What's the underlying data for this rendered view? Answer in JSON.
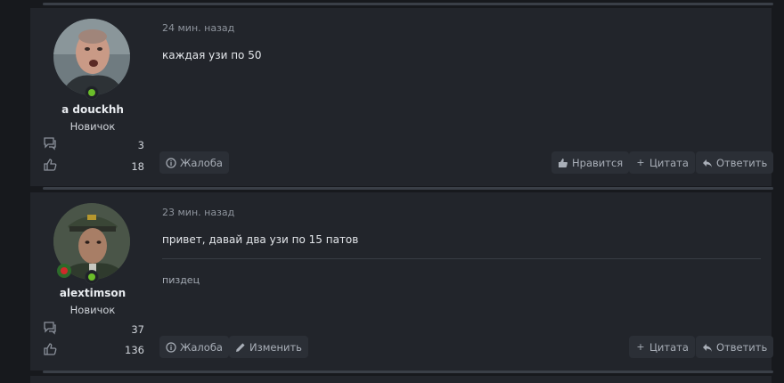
{
  "posts": [
    {
      "time": "24 мин. назад",
      "username": "a douckhh",
      "rank": "Новичок",
      "messages_count": "3",
      "likes_count": "18",
      "text": "каждая узи по 50",
      "signature": "",
      "buttons": {
        "report": "Жалоба",
        "like": "Нравится",
        "quote": "Цитата",
        "reply": "Ответить"
      }
    },
    {
      "time": "23 мин. назад",
      "username": "alextimson",
      "rank": "Новичок",
      "messages_count": "37",
      "likes_count": "136",
      "text": "привет, давай два узи по 15 патов",
      "signature": "пиздец",
      "buttons": {
        "report": "Жалоба",
        "edit": "Изменить",
        "quote": "Цитата",
        "reply": "Ответить"
      }
    }
  ],
  "colors": {
    "online": "#6bbd2a",
    "panel": "#22252b",
    "background": "#17191d"
  }
}
